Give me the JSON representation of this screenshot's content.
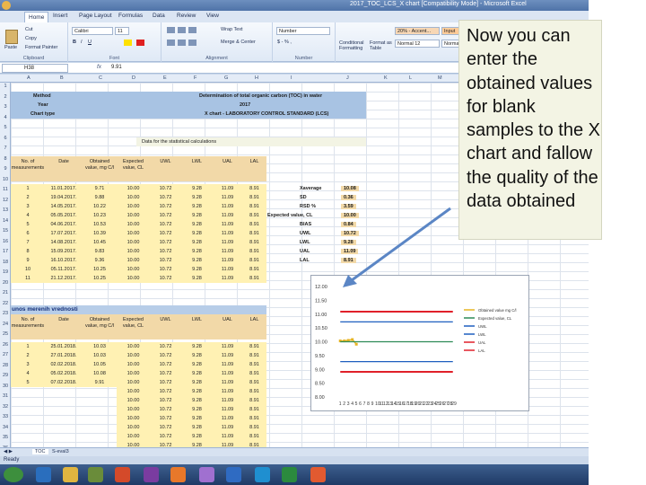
{
  "window": {
    "title": "2017_TOC_LCS_X chart [Compatibility Mode] - Microsoft Excel"
  },
  "ribbon": {
    "tabs": [
      "Home",
      "Insert",
      "Page Layout",
      "Formulas",
      "Data",
      "Review",
      "View"
    ],
    "clipboard": {
      "cut": "Cut",
      "copy": "Copy",
      "paste": "Paste",
      "format_painter": "Format Painter",
      "label": "Clipboard"
    },
    "font": {
      "name": "Calibri",
      "size": "11",
      "label": "Font"
    },
    "alignment": {
      "wrap": "Wrap Text",
      "merge": "Merge & Center",
      "label": "Alignment"
    },
    "number": {
      "format": "Number",
      "label": "Number"
    },
    "styles": {
      "conditional": "Conditional Formatting",
      "format_table": "Format as Table",
      "normal": "Normal 12",
      "style1": "20% - Accent...",
      "style2": "Input",
      "style3": "Normal"
    }
  },
  "formula_bar": {
    "name_box": "H38",
    "fx": "fx",
    "value": "9.91"
  },
  "columns": [
    "A",
    "B",
    "C",
    "D",
    "E",
    "F",
    "G",
    "H",
    "I",
    "J",
    "K",
    "L",
    "M"
  ],
  "rows": [
    "1",
    "2",
    "3",
    "4",
    "5",
    "6",
    "7",
    "8",
    "9",
    "10",
    "11",
    "12",
    "13",
    "14",
    "15",
    "16",
    "17",
    "18",
    "19",
    "20",
    "21",
    "22",
    "23",
    "24",
    "25",
    "26",
    "27",
    "28",
    "29",
    "30",
    "31",
    "32",
    "33",
    "34",
    "35",
    "36"
  ],
  "sheet": {
    "method_label": "Method",
    "method_value": "Determination of total organic carbon (TOC) in water",
    "year_label": "Year",
    "year_value": "2017",
    "chart_type_label": "Chart type",
    "chart_type_value": "X chart - LABORATORY CONTROL STANDARD (LCS)",
    "data_title": "Data for the statistical calculations",
    "headers": [
      "No. of measurements",
      "Date",
      "Obtained value, mg C/l",
      "Expected value, CL",
      "UWL",
      "LWL",
      "UAL",
      "LAL"
    ],
    "rows2017": [
      [
        "1",
        "11.01.2017.",
        "9.71",
        "10.00",
        "10.72",
        "9.28",
        "11.09",
        "8.91"
      ],
      [
        "2",
        "19.04.2017.",
        "9.88",
        "10.00",
        "10.72",
        "9.28",
        "11.09",
        "8.91"
      ],
      [
        "3",
        "14.05.2017.",
        "10.22",
        "10.00",
        "10.72",
        "9.28",
        "11.09",
        "8.91"
      ],
      [
        "4",
        "05.05.2017.",
        "10.23",
        "10.00",
        "10.72",
        "9.28",
        "11.09",
        "8.91"
      ],
      [
        "5",
        "04.06.2017.",
        "10.53",
        "10.00",
        "10.72",
        "9.28",
        "11.09",
        "8.91"
      ],
      [
        "6",
        "17.07.2017.",
        "10.39",
        "10.00",
        "10.72",
        "9.28",
        "11.09",
        "8.91"
      ],
      [
        "7",
        "14.08.2017.",
        "10.45",
        "10.00",
        "10.72",
        "9.28",
        "11.09",
        "8.91"
      ],
      [
        "8",
        "15.09.2017.",
        "9.83",
        "10.00",
        "10.72",
        "9.28",
        "11.09",
        "8.91"
      ],
      [
        "9",
        "16.10.2017.",
        "9.36",
        "10.00",
        "10.72",
        "9.28",
        "11.09",
        "8.91"
      ],
      [
        "10",
        "05.11.2017.",
        "10.25",
        "10.00",
        "10.72",
        "9.28",
        "11.09",
        "8.91"
      ],
      [
        "11",
        "21.12.2017.",
        "10.25",
        "10.00",
        "10.72",
        "9.28",
        "11.09",
        "8.91"
      ]
    ],
    "stats": [
      [
        "Xaverage",
        "10.08"
      ],
      [
        "SD",
        "0.36"
      ],
      [
        "RSD %",
        "3.59"
      ],
      [
        "Expected value, CL",
        "10.00"
      ],
      [
        "BIAS",
        "0.84"
      ],
      [
        "UWL",
        "10.72"
      ],
      [
        "LWL",
        "9.28"
      ],
      [
        "UAL",
        "11.09"
      ],
      [
        "LAL",
        "8.91"
      ]
    ],
    "section2_title": "unos merenih vrednosti",
    "headers2": [
      "No. of measurements",
      "Date",
      "Obtained value, mg C/l",
      "Expected value, CL",
      "UWL",
      "LWL",
      "UAL",
      "LAL"
    ],
    "rows2018": [
      [
        "1",
        "25.01.2018.",
        "10.03",
        "10.00",
        "10.72",
        "9.28",
        "11.09",
        "8.91"
      ],
      [
        "2",
        "27.01.2018.",
        "10.03",
        "10.00",
        "10.72",
        "9.28",
        "11.09",
        "8.91"
      ],
      [
        "3",
        "02.02.2018.",
        "10.05",
        "10.00",
        "10.72",
        "9.28",
        "11.09",
        "8.91"
      ],
      [
        "4",
        "05.02.2018.",
        "10.08",
        "10.00",
        "10.72",
        "9.28",
        "11.09",
        "8.91"
      ],
      [
        "5",
        "07.02.2018.",
        "9.91",
        "10.00",
        "10.72",
        "9.28",
        "11.09",
        "8.91"
      ]
    ],
    "limit_row": [
      "10.00",
      "10.72",
      "9.28",
      "11.09",
      "8.91"
    ],
    "limit_rows_count_note": ""
  },
  "chart_data": {
    "type": "line",
    "x": [
      "1",
      "2",
      "3",
      "4",
      "5",
      "6",
      "7",
      "8",
      "9",
      "10",
      "11",
      "12",
      "13",
      "14",
      "15",
      "16",
      "17",
      "18",
      "19",
      "20",
      "21",
      "22",
      "23",
      "24",
      "25",
      "26",
      "27",
      "28",
      "29"
    ],
    "series": [
      {
        "name": "Obtained value mg C/l",
        "color": "#e6b422",
        "values": [
          10.03,
          10.03,
          10.05,
          10.08,
          9.91
        ]
      },
      {
        "name": "Expected value, CL",
        "color": "#2e8b57",
        "values": [
          10.0,
          10.0,
          10.0,
          10.0,
          10.0,
          10.0,
          10.0,
          10.0,
          10.0,
          10.0,
          10.0,
          10.0,
          10.0,
          10.0,
          10.0,
          10.0,
          10.0,
          10.0,
          10.0,
          10.0,
          10.0,
          10.0,
          10.0,
          10.0,
          10.0,
          10.0,
          10.0,
          10.0,
          10.0
        ]
      },
      {
        "name": "UWL",
        "color": "#1f5fbf",
        "values": [
          10.72,
          10.72,
          10.72,
          10.72,
          10.72,
          10.72,
          10.72,
          10.72,
          10.72,
          10.72,
          10.72,
          10.72,
          10.72,
          10.72,
          10.72,
          10.72,
          10.72,
          10.72,
          10.72,
          10.72,
          10.72,
          10.72,
          10.72,
          10.72,
          10.72,
          10.72,
          10.72,
          10.72,
          10.72
        ]
      },
      {
        "name": "LWL",
        "color": "#1f5fbf",
        "values": [
          9.28,
          9.28,
          9.28,
          9.28,
          9.28,
          9.28,
          9.28,
          9.28,
          9.28,
          9.28,
          9.28,
          9.28,
          9.28,
          9.28,
          9.28,
          9.28,
          9.28,
          9.28,
          9.28,
          9.28,
          9.28,
          9.28,
          9.28,
          9.28,
          9.28,
          9.28,
          9.28,
          9.28,
          9.28
        ]
      },
      {
        "name": "UAL",
        "color": "#e0202a",
        "values": [
          11.09,
          11.09,
          11.09,
          11.09,
          11.09,
          11.09,
          11.09,
          11.09,
          11.09,
          11.09,
          11.09,
          11.09,
          11.09,
          11.09,
          11.09,
          11.09,
          11.09,
          11.09,
          11.09,
          11.09,
          11.09,
          11.09,
          11.09,
          11.09,
          11.09,
          11.09,
          11.09,
          11.09,
          11.09
        ]
      },
      {
        "name": "LAL",
        "color": "#e0202a",
        "values": [
          8.91,
          8.91,
          8.91,
          8.91,
          8.91,
          8.91,
          8.91,
          8.91,
          8.91,
          8.91,
          8.91,
          8.91,
          8.91,
          8.91,
          8.91,
          8.91,
          8.91,
          8.91,
          8.91,
          8.91,
          8.91,
          8.91,
          8.91,
          8.91,
          8.91,
          8.91,
          8.91,
          8.91,
          8.91
        ]
      }
    ],
    "ylim": [
      8.0,
      12.0
    ],
    "yticks": [
      "12.00",
      "11.50",
      "11.00",
      "10.50",
      "10.00",
      "9.50",
      "9.00",
      "8.50",
      "8.00"
    ],
    "legend": "right",
    "grid": false
  },
  "sheet_tabs": [
    "TOC",
    "S-eval3"
  ],
  "status": "Ready",
  "callout": {
    "text": "Now you can enter the obtained values for blank samples to the X chart and fallow the quality of the data obtained"
  },
  "colors": {
    "header_blue": "#b7cde8",
    "title_blue": "#a8c3e3",
    "tan": "#f2d9a8",
    "yellow_row": "#fff1b3",
    "accent_arrow": "#5b86c5"
  }
}
